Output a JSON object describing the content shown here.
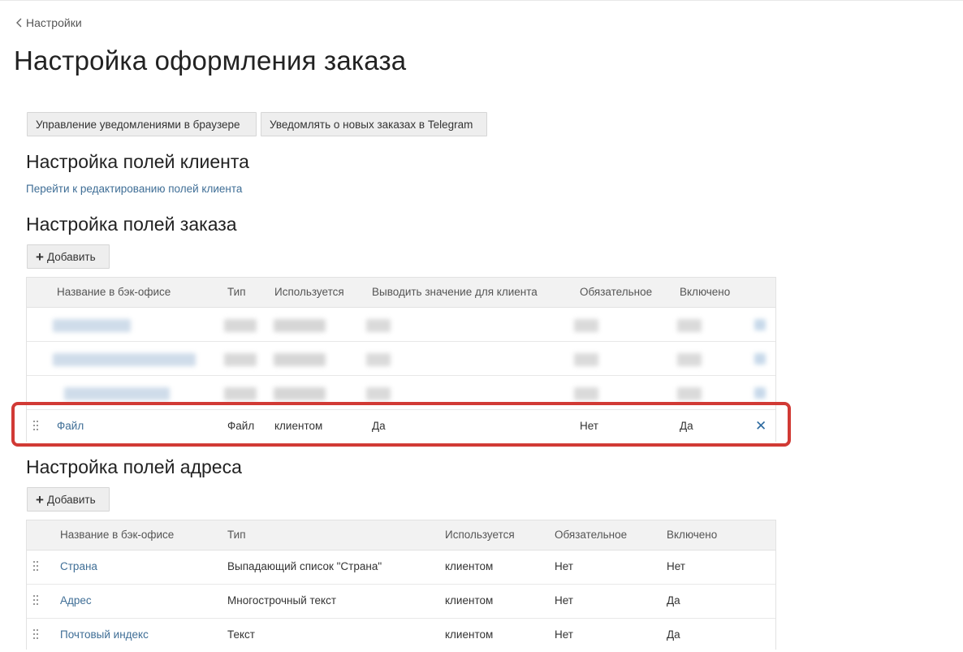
{
  "breadcrumb": {
    "label": "Настройки"
  },
  "page": {
    "title": "Настройка оформления заказа"
  },
  "actions": {
    "browser_notifications": "Управление уведомлениями в браузере",
    "telegram_notifications": "Уведомлять о новых заказах в Telegram"
  },
  "client_fields": {
    "title": "Настройка полей клиента",
    "link": "Перейти к редактированию полей клиента"
  },
  "order_fields": {
    "title": "Настройка полей заказа",
    "add_label": "Добавить",
    "columns": [
      "Название в бэк-офисе",
      "Тип",
      "Используется",
      "Выводить значение для клиента",
      "Обязательное",
      "Включено"
    ],
    "rows": [
      {
        "name": "Файл",
        "type": "Файл",
        "used_by": "клиентом",
        "show_to_client": "Да",
        "required": "Нет",
        "enabled": "Да"
      }
    ]
  },
  "address_fields": {
    "title": "Настройка полей адреса",
    "add_label": "Добавить",
    "columns": [
      "Название в бэк-офисе",
      "Тип",
      "Используется",
      "Обязательное",
      "Включено"
    ],
    "rows": [
      {
        "name": "Страна",
        "type": "Выпадающий список \"Страна\"",
        "used_by": "клиентом",
        "required": "Нет",
        "enabled": "Нет"
      },
      {
        "name": "Адрес",
        "type": "Многострочный текст",
        "used_by": "клиентом",
        "required": "Нет",
        "enabled": "Да"
      },
      {
        "name": "Почтовый индекс",
        "type": "Текст",
        "used_by": "клиентом",
        "required": "Нет",
        "enabled": "Да"
      }
    ]
  },
  "icons": {
    "back": "chevron-left-icon",
    "plus": "plus-icon",
    "drag": "drag-handle-icon",
    "delete": "close-icon"
  },
  "colors": {
    "link": "#3f6e96",
    "highlight": "#d13a35",
    "delete_icon": "#2d6a9f",
    "header_bg": "#f2f2f2"
  }
}
